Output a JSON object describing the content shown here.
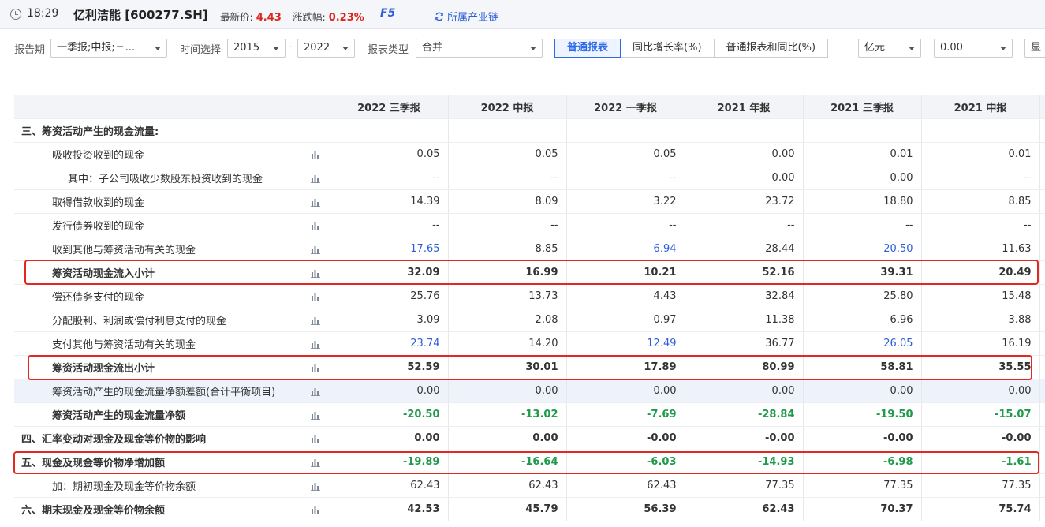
{
  "topbar": {
    "time": "18:29",
    "stock_name": "亿利洁能 [600277.SH]",
    "latest_price_label": "最新价:",
    "latest_price": "4.43",
    "change_label": "涨跌幅:",
    "change": "0.23%",
    "f5": "F5",
    "chain_label": "所属产业链"
  },
  "filters": {
    "period_label": "报告期",
    "period_value": "一季报;中报;三...",
    "time_label": "时间选择",
    "year_from": "2015",
    "dash": "-",
    "year_to": "2022",
    "type_label": "报表类型",
    "type_value": "合并",
    "tabs": [
      "普通报表",
      "同比增长率(%)",
      "普通报表和同比(%)"
    ],
    "unit_value": "亿元",
    "decimal_value": "0.00",
    "display_value": "显"
  },
  "table": {
    "headers": [
      "2022 三季报",
      "2022 中报",
      "2022 一季报",
      "2021 年报",
      "2021 三季报",
      "2021 中报"
    ],
    "rows": [
      {
        "name": "三、筹资活动产生的现金流量:",
        "values": [
          "",
          "",
          "",
          "",
          "",
          ""
        ]
      },
      {
        "name": "吸收投资收到的现金",
        "values": [
          "0.05",
          "0.05",
          "0.05",
          "0.00",
          "0.01",
          "0.01"
        ]
      },
      {
        "name": "其中：子公司吸收少数股东投资收到的现金",
        "values": [
          "--",
          "--",
          "--",
          "0.00",
          "0.00",
          "--"
        ]
      },
      {
        "name": "取得借款收到的现金",
        "values": [
          "14.39",
          "8.09",
          "3.22",
          "23.72",
          "18.80",
          "8.85"
        ]
      },
      {
        "name": "发行债券收到的现金",
        "values": [
          "--",
          "--",
          "--",
          "--",
          "--",
          "--"
        ]
      },
      {
        "name": "收到其他与筹资活动有关的现金",
        "values": [
          "17.65",
          "8.85",
          "6.94",
          "28.44",
          "20.50",
          "11.63"
        ]
      },
      {
        "name": "筹资活动现金流入小计",
        "values": [
          "32.09",
          "16.99",
          "10.21",
          "52.16",
          "39.31",
          "20.49"
        ]
      },
      {
        "name": "偿还债务支付的现金",
        "values": [
          "25.76",
          "13.73",
          "4.43",
          "32.84",
          "25.80",
          "15.48"
        ]
      },
      {
        "name": "分配股利、利润或偿付利息支付的现金",
        "values": [
          "3.09",
          "2.08",
          "0.97",
          "11.38",
          "6.96",
          "3.88"
        ]
      },
      {
        "name": "支付其他与筹资活动有关的现金",
        "values": [
          "23.74",
          "14.20",
          "12.49",
          "36.77",
          "26.05",
          "16.19"
        ]
      },
      {
        "name": "筹资活动现金流出小计",
        "values": [
          "52.59",
          "30.01",
          "17.89",
          "80.99",
          "58.81",
          "35.55"
        ]
      },
      {
        "name": "筹资活动产生的现金流量净额差额(合计平衡项目)",
        "values": [
          "0.00",
          "0.00",
          "0.00",
          "0.00",
          "0.00",
          "0.00"
        ]
      },
      {
        "name": "筹资活动产生的现金流量净额",
        "values": [
          "-20.50",
          "-13.02",
          "-7.69",
          "-28.84",
          "-19.50",
          "-15.07"
        ]
      },
      {
        "name": "四、汇率变动对现金及现金等价物的影响",
        "values": [
          "0.00",
          "0.00",
          "-0.00",
          "-0.00",
          "-0.00",
          "-0.00"
        ]
      },
      {
        "name": "五、现金及现金等价物净增加额",
        "values": [
          "-19.89",
          "-16.64",
          "-6.03",
          "-14.93",
          "-6.98",
          "-1.61"
        ]
      },
      {
        "name": "加：期初现金及现金等价物余额",
        "values": [
          "62.43",
          "62.43",
          "62.43",
          "77.35",
          "77.35",
          "77.35"
        ]
      },
      {
        "name": "六、期末现金及现金等价物余额",
        "values": [
          "42.53",
          "45.79",
          "56.39",
          "62.43",
          "70.37",
          "75.74"
        ]
      }
    ]
  },
  "colors": {
    "accent_blue": "#2e5fd8",
    "price_red": "#d9261c",
    "negative_green": "#1e9a4a",
    "highlight_red": "#e3291f"
  }
}
